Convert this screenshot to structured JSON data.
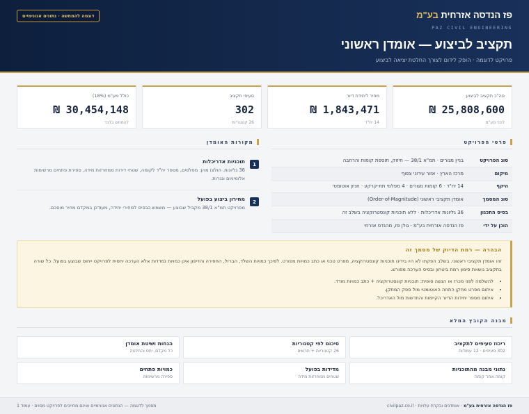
{
  "brand": {
    "name_main": "פז הנדסה אזרחית",
    "name_suffix": "בע\"מ",
    "subtitle": "PAZ CIVIL ENGINEERING"
  },
  "demo_badge": "דוגמה להמחשה · נתונים אנונימיים",
  "title": "תקציב לביצוע — אומדן ראשוני",
  "subtitle": "פרויקט לדוגמה · הופק לידום לצורך החלטת יציאה לביצוע",
  "kpis": [
    {
      "label": "סה\"כ תקציב לביצוע",
      "value": "₪ 25,808,600",
      "note": "לפני מע\"מ"
    },
    {
      "label": "מחיר ליחידת דיור",
      "value": "₪ 1,843,471",
      "note": "14 יח\"ד"
    },
    {
      "label": "סעיפי תקציב",
      "value": "302",
      "note": "26 קטגוריות"
    },
    {
      "label": "כולל מע\"מ (18%)",
      "value": "₪ 30,454,148",
      "note": "להמחש בלבד"
    }
  ],
  "details": {
    "heading": "פרטי הפרויקט",
    "rows": [
      {
        "key": "סוג הפרויקט",
        "value": "בניין מגורים · תמ\"א 38/1 — חיזוק, תוספת קומות והרחבה"
      },
      {
        "key": "מיקום",
        "value": "מרכז הארץ · אזור עירוני צפוף"
      },
      {
        "key": "היקף",
        "value": "14 יח\"ד · 6 קומות מגורים · 4 מפלסי תת-קרקע · חניון אוטומטי"
      },
      {
        "key": "סוג המסמך",
        "value": "אומדן תקציבי ראשוני (Order-of-Magnitude)"
      },
      {
        "key": "בסיס התכנון",
        "value": "36 גליונות אדריכלות · ללא תוכניות קונסטרוקציה בשלב זה"
      },
      {
        "key": "הוכן על ידי",
        "value": "פז הנדסה אזרחית בע\"מ · גולן פז, מהנדס אזרחי"
      }
    ]
  },
  "sources": {
    "heading": "מקורות האומדן",
    "items": [
      {
        "num": "1",
        "title": "תוכניות אדריכלות",
        "desc": "36 גליונות. הולצו מהן: מפלסים, מספר יח\"ד לקומה, שטחי דירות ממחרזות מידה, ספירת פתחים מרשימות אלומיניום ונגרות."
      },
      {
        "num": "2",
        "title": "מחירון ביצוע בפועל",
        "desc": "מפרויקט תמ\"א 38/1 מקביל שבוצע — משמש כבסיס למחירי יחידה, מעודכן במקדם מחיר מוסכם."
      }
    ]
  },
  "disclaimer": {
    "title": "הבהרה — רמת הדיוק של מסמך זה",
    "text": "זהו אומדן תקציבי ראשוני. בשלב הפקתו לא היו בידינו תוכניות קונסטרוקציה, מפרט טכני או כתב כמויות מפורט. לפיכך כמויות השלד, הברזל, החפירה והדיפון אינן כמויות נמדדות אלא הערכה יחסית לפרויקט ייחוס שבוצע בפועל. כל שורה בתקציב נושאת סימון רמת ביטחון ובסיס הערכה מפורש.",
    "items": [
      "להשלמה לפני מכרז או הגשה סופית: תוכניות קונסטרוקציה + כתב כמויות מודד.",
      "איתום מפרט מחקן התחה האוטומטי מול ספק המתקן.",
      "איתום מספר יחידות הדיור הקיימות והחדשות מול האדריכל."
    ]
  },
  "package": {
    "heading": "מבנה הקובץ המלא",
    "cards": [
      {
        "title": "ריכוז סעיפים לתקציב",
        "sub": "302 סעיפים · 12 עמודות"
      },
      {
        "title": "סיכום לפי קטגוריות",
        "sub": "26 קטגוריות + תרשים"
      },
      {
        "title": "הנחות ושיטת אומדן",
        "sub": "כל מקדם, יחס והחלטה"
      },
      {
        "title": "נתוני מבנה מהתוכניות",
        "sub": "קומה אחר קומה"
      },
      {
        "title": "מדידות בפועל",
        "sub": "שטחים ממחרזות מידה"
      },
      {
        "title": "כמויות פתחים",
        "sub": "ספירה מרשימות"
      }
    ]
  },
  "footer": {
    "right_bold": "פז הנדסה אזרחית בע\"מ",
    "right_rest": " · אומדנים ובקרת עלויות · civilpaz.co.il",
    "left": "מסמך לדוגמה — הנתונים אנונימיים ואינם מחייבים לפרויקט מסוים · עמוד 1"
  },
  "colors": {
    "navy": "#0d1f3d",
    "gold": "#c9a14a",
    "note_bg": "#fbf5e2"
  }
}
